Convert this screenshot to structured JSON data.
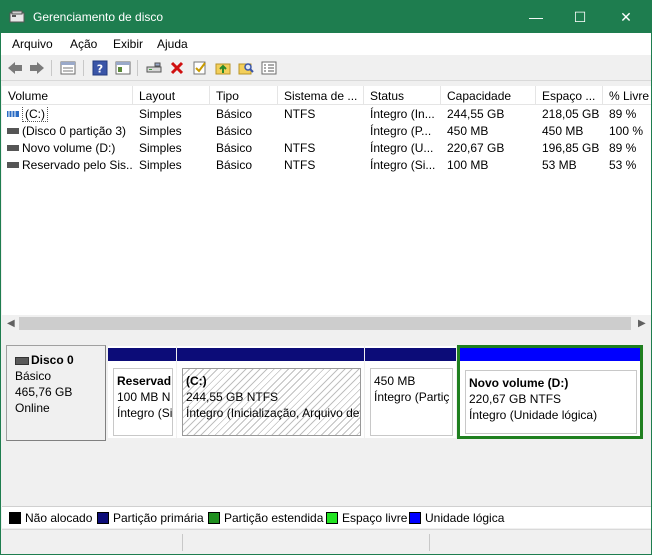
{
  "window": {
    "title": "Gerenciamento de disco",
    "minimize_glyph": "—",
    "maximize_glyph": "☐",
    "close_glyph": "✕"
  },
  "menu": {
    "items": [
      "Arquivo",
      "Ação",
      "Exibir",
      "Ajuda"
    ]
  },
  "toolbar": {
    "icons": [
      "back-arrow-icon",
      "forward-arrow-icon",
      "disk-list-icon",
      "help-icon",
      "properties-icon",
      "connect-icon",
      "delete-icon",
      "check-icon",
      "folder-up-icon",
      "search-icon",
      "list-icon"
    ]
  },
  "table": {
    "columns": [
      "Volume",
      "Layout",
      "Tipo",
      "Sistema de ...",
      "Status",
      "Capacidade",
      "Espaço ...",
      "% Livre"
    ],
    "rows": [
      {
        "volume": "(C:)",
        "layout": "Simples",
        "tipo": "Básico",
        "sistema": "NTFS",
        "status": "Íntegro (In...",
        "capacidade": "244,55 GB",
        "espaco": "218,05 GB",
        "livre": "89 %",
        "icon": "striped-volume-icon"
      },
      {
        "volume": "(Disco 0 partição 3)",
        "layout": "Simples",
        "tipo": "Básico",
        "sistema": "",
        "status": "Íntegro (P...",
        "capacidade": "450 MB",
        "espaco": "450 MB",
        "livre": "100 %",
        "icon": "volume-icon"
      },
      {
        "volume": "Novo volume (D:)",
        "layout": "Simples",
        "tipo": "Básico",
        "sistema": "NTFS",
        "status": "Íntegro (U...",
        "capacidade": "220,67 GB",
        "espaco": "196,85 GB",
        "livre": "89 %",
        "icon": "volume-icon"
      },
      {
        "volume": "Reservado pelo Sis...",
        "layout": "Simples",
        "tipo": "Básico",
        "sistema": "NTFS",
        "status": "Íntegro (Si...",
        "capacidade": "100 MB",
        "espaco": "53 MB",
        "livre": "53 %",
        "icon": "volume-icon"
      }
    ]
  },
  "disk": {
    "name": "Disco 0",
    "type": "Básico",
    "size": "465,76 GB",
    "state": "Online",
    "partitions": [
      {
        "name": "Reservad",
        "size": "100 MB N",
        "status": "Íntegro (Si"
      },
      {
        "name": "(C:)",
        "size": "244,55 GB NTFS",
        "status": "Íntegro (Inicialização, Arquivo de"
      },
      {
        "name": "",
        "size": "450 MB",
        "status": "Íntegro (Partiç"
      },
      {
        "name": "Novo volume  (D:)",
        "size": "220,67 GB NTFS",
        "status": "Íntegro (Unidade lógica)"
      }
    ]
  },
  "legend": [
    {
      "label": "Não alocado",
      "color": "#000000"
    },
    {
      "label": "Partição primária",
      "color": "#0c0c78"
    },
    {
      "label": "Partição estendida",
      "color": "#1f8f1f"
    },
    {
      "label": "Espaço livre",
      "color": "#22e322"
    },
    {
      "label": "Unidade lógica",
      "color": "#0000ff"
    }
  ]
}
